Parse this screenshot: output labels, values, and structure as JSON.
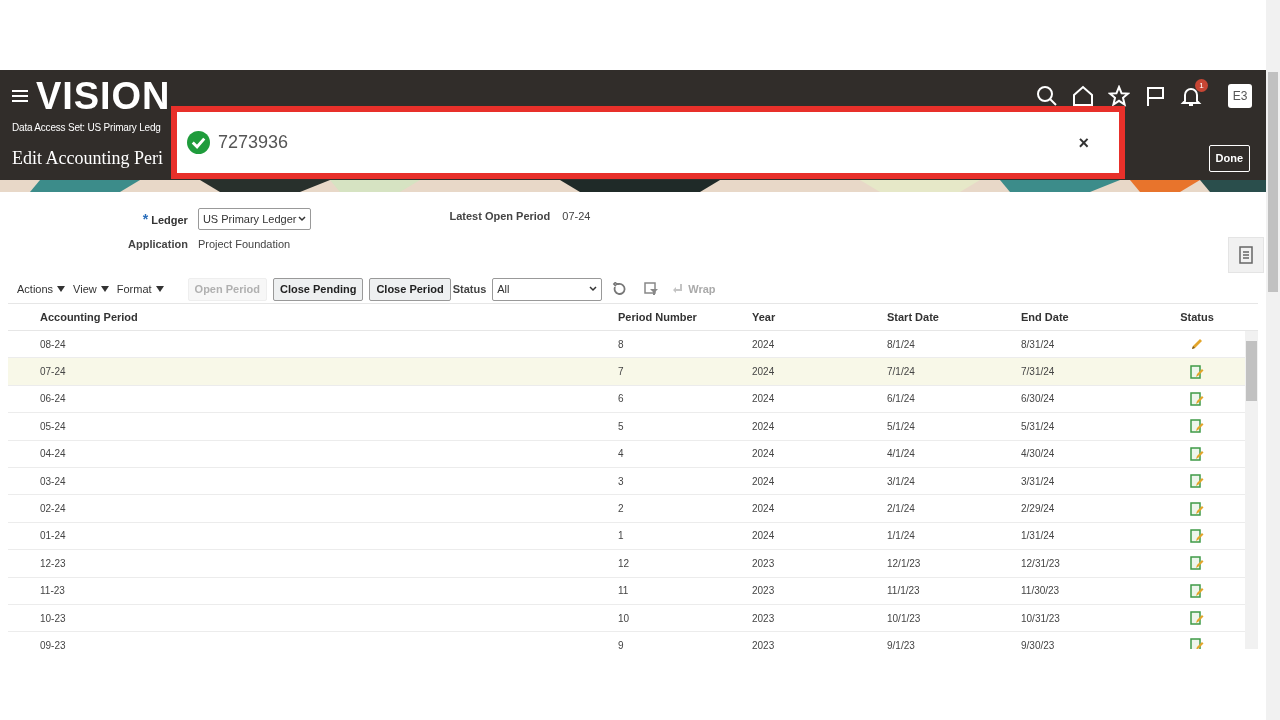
{
  "header": {
    "logo": "VISION",
    "notifications_count": "1",
    "user_initials": "E3",
    "data_access_set": "Data Access Set:  US Primary Ledg",
    "page_title": "Edit Accounting Peri",
    "done_button": "Done"
  },
  "toast": {
    "message": "7273936",
    "close": "×"
  },
  "form": {
    "ledger_required_mark": "*",
    "ledger_label": "Ledger",
    "ledger_value": "US Primary Ledger",
    "application_label": "Application",
    "application_value": "Project Foundation",
    "latest_open_period_label": "Latest Open Period",
    "latest_open_period_value": "07-24"
  },
  "toolbar": {
    "menus": [
      "Actions",
      "View",
      "Format"
    ],
    "buttons": [
      {
        "label": "Open Period",
        "disabled": true
      },
      {
        "label": "Close Pending",
        "disabled": false
      },
      {
        "label": "Close Period",
        "disabled": false
      }
    ],
    "status_label": "Status",
    "status_value": "All",
    "wrap": "Wrap"
  },
  "table": {
    "columns": [
      "Accounting Period",
      "Period Number",
      "Year",
      "Start Date",
      "End Date",
      "Status"
    ],
    "rows": [
      {
        "cells": [
          "08-24",
          "8",
          "2024",
          "8/1/24",
          "8/31/24"
        ],
        "kind": "pencil",
        "selected": false
      },
      {
        "cells": [
          "07-24",
          "7",
          "2024",
          "7/1/24",
          "7/31/24"
        ],
        "kind": "note",
        "selected": true
      },
      {
        "cells": [
          "06-24",
          "6",
          "2024",
          "6/1/24",
          "6/30/24"
        ],
        "kind": "note",
        "selected": false
      },
      {
        "cells": [
          "05-24",
          "5",
          "2024",
          "5/1/24",
          "5/31/24"
        ],
        "kind": "note",
        "selected": false
      },
      {
        "cells": [
          "04-24",
          "4",
          "2024",
          "4/1/24",
          "4/30/24"
        ],
        "kind": "note",
        "selected": false
      },
      {
        "cells": [
          "03-24",
          "3",
          "2024",
          "3/1/24",
          "3/31/24"
        ],
        "kind": "note",
        "selected": false
      },
      {
        "cells": [
          "02-24",
          "2",
          "2024",
          "2/1/24",
          "2/29/24"
        ],
        "kind": "note",
        "selected": false
      },
      {
        "cells": [
          "01-24",
          "1",
          "2024",
          "1/1/24",
          "1/31/24"
        ],
        "kind": "note",
        "selected": false
      },
      {
        "cells": [
          "12-23",
          "12",
          "2023",
          "12/1/23",
          "12/31/23"
        ],
        "kind": "note",
        "selected": false
      },
      {
        "cells": [
          "11-23",
          "11",
          "2023",
          "11/1/23",
          "11/30/23"
        ],
        "kind": "note",
        "selected": false
      },
      {
        "cells": [
          "10-23",
          "10",
          "2023",
          "10/1/23",
          "10/31/23"
        ],
        "kind": "note",
        "selected": false
      },
      {
        "cells": [
          "09-23",
          "9",
          "2023",
          "9/1/23",
          "9/30/23"
        ],
        "kind": "note",
        "selected": false
      }
    ]
  }
}
